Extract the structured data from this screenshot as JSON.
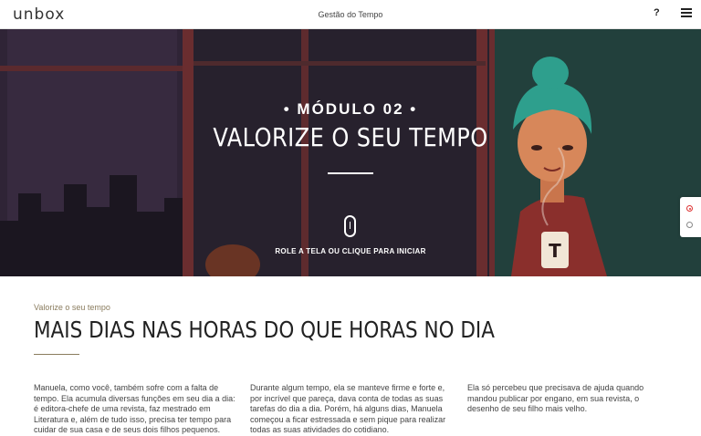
{
  "header": {
    "logo": "unbox",
    "course_title": "Gestão do Tempo",
    "help_label": "?",
    "menu_icon": "hamburger-menu-icon"
  },
  "hero": {
    "module_label": "• MÓDULO 02 •",
    "title": "VALORIZE O SEU TEMPO",
    "scroll_icon": "mouse-scroll-icon",
    "scroll_cta": "ROLE A TELA OU CLIQUE PARA INICIAR"
  },
  "side_nav": {
    "active_index": 0,
    "dots": 2
  },
  "content": {
    "section_label": "Valorize o seu tempo",
    "title": "MAIS DIAS NAS HORAS DO QUE HORAS NO DIA",
    "columns": [
      "Manuela, como você, também sofre com a falta de tempo. Ela acumula diversas funções em seu dia a dia: é editora-chefe de uma revista, faz mestrado em Literatura e, além de tudo isso, precisa ter tempo para cuidar de sua casa e de seus dois filhos pequenos.",
      "Durante algum tempo, ela se manteve firme e forte e, por incrível que pareça, dava conta de todas as suas tarefas do dia a dia. Porém, há alguns dias, Manuela começou a ficar estressada e sem pique para realizar todas as suas atividades do cotidiano.",
      "Ela só percebeu que precisava de ajuda quando mandou publicar por engano, em sua revista, o desenho de seu filho mais velho."
    ]
  },
  "colors": {
    "accent_gold": "#8a7c5e",
    "hero_dark": "#231b2b",
    "window_green": "#2c4a45",
    "active_dot": "#dd3333"
  }
}
